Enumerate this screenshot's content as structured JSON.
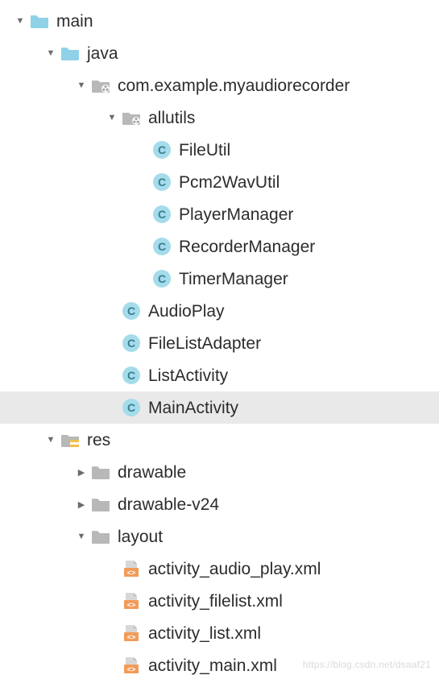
{
  "tree": [
    {
      "id": "main",
      "depth": 0,
      "toggle": "down",
      "icon": "folder-blue",
      "label": "main",
      "interactable": true
    },
    {
      "id": "java",
      "depth": 1,
      "toggle": "down",
      "icon": "folder-blue",
      "label": "java",
      "interactable": true
    },
    {
      "id": "pkg",
      "depth": 2,
      "toggle": "down",
      "icon": "package",
      "label": "com.example.myaudiorecorder",
      "interactable": true
    },
    {
      "id": "allutils",
      "depth": 3,
      "toggle": "down",
      "icon": "package",
      "label": "allutils",
      "interactable": true
    },
    {
      "id": "FileUtil",
      "depth": 4,
      "toggle": "none",
      "icon": "class",
      "label": "FileUtil",
      "interactable": true
    },
    {
      "id": "Pcm2WavUtil",
      "depth": 4,
      "toggle": "none",
      "icon": "class",
      "label": "Pcm2WavUtil",
      "interactable": true
    },
    {
      "id": "PlayerManager",
      "depth": 4,
      "toggle": "none",
      "icon": "class",
      "label": "PlayerManager",
      "interactable": true
    },
    {
      "id": "RecorderManager",
      "depth": 4,
      "toggle": "none",
      "icon": "class",
      "label": "RecorderManager",
      "interactable": true
    },
    {
      "id": "TimerManager",
      "depth": 4,
      "toggle": "none",
      "icon": "class",
      "label": "TimerManager",
      "interactable": true
    },
    {
      "id": "AudioPlay",
      "depth": 3,
      "toggle": "none",
      "icon": "class",
      "label": "AudioPlay",
      "interactable": true
    },
    {
      "id": "FileListAdapter",
      "depth": 3,
      "toggle": "none",
      "icon": "class",
      "label": "FileListAdapter",
      "interactable": true
    },
    {
      "id": "ListActivity",
      "depth": 3,
      "toggle": "none",
      "icon": "class",
      "label": "ListActivity",
      "interactable": true
    },
    {
      "id": "MainActivity",
      "depth": 3,
      "toggle": "none",
      "icon": "class",
      "label": "MainActivity",
      "interactable": true,
      "selected": true
    },
    {
      "id": "res",
      "depth": 1,
      "toggle": "down",
      "icon": "res-folder",
      "label": "res",
      "interactable": true
    },
    {
      "id": "drawable",
      "depth": 2,
      "toggle": "right",
      "icon": "folder-gray",
      "label": "drawable",
      "interactable": true
    },
    {
      "id": "drawable24",
      "depth": 2,
      "toggle": "right",
      "icon": "folder-gray",
      "label": "drawable-v24",
      "interactable": true
    },
    {
      "id": "layout",
      "depth": 2,
      "toggle": "down",
      "icon": "folder-gray",
      "label": "layout",
      "interactable": true
    },
    {
      "id": "act_audio",
      "depth": 3,
      "toggle": "none",
      "icon": "xml",
      "label": "activity_audio_play.xml",
      "interactable": true
    },
    {
      "id": "act_fl",
      "depth": 3,
      "toggle": "none",
      "icon": "xml",
      "label": "activity_filelist.xml",
      "interactable": true
    },
    {
      "id": "act_list",
      "depth": 3,
      "toggle": "none",
      "icon": "xml",
      "label": "activity_list.xml",
      "interactable": true
    },
    {
      "id": "act_main",
      "depth": 3,
      "toggle": "none",
      "icon": "xml",
      "label": "activity_main.xml",
      "interactable": true
    }
  ],
  "icons": {
    "class_letter": "C"
  },
  "colors": {
    "folder_blue": "#8fd2e8",
    "folder_gray": "#b8b8b8",
    "class_bg": "#a4dceb",
    "class_fg": "#3a7d91",
    "xml_orange": "#f29b59",
    "xml_page": "#d7d7d7",
    "res_stripe": "#f2c14e",
    "selected": "#e9e9e9"
  },
  "watermark": "https://blog.csdn.net/dsaaf21"
}
